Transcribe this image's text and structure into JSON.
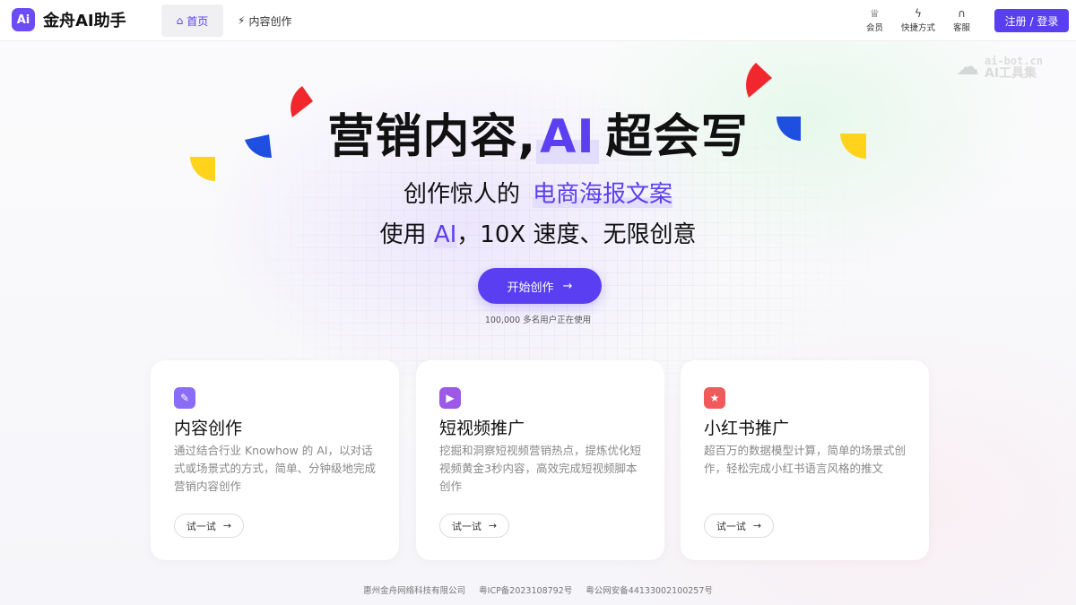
{
  "header": {
    "logo_mark": "Ai",
    "app_name": "金舟AI助手",
    "nav": [
      {
        "label": "首页",
        "icon": "home-icon",
        "active": true
      },
      {
        "label": "内容创作",
        "icon": "lightning-icon",
        "active": false
      }
    ],
    "tools": [
      {
        "label": "会员",
        "icon": "crown-icon"
      },
      {
        "label": "快捷方式",
        "icon": "lightning-icon"
      },
      {
        "label": "客服",
        "icon": "headset-icon"
      }
    ],
    "login_label": "注册 / 登录"
  },
  "watermark": {
    "url": "ai-bot.cn",
    "name": "AI工具集"
  },
  "hero": {
    "title_prefix": "营销内容,",
    "title_ai": "AI",
    "title_suffix": "超会写",
    "sub1_prefix": "创作惊人的",
    "sub1_highlight": "电商海报文案",
    "sub2_prefix": "使用",
    "sub2_ai": "AI",
    "sub2_suffix": "，10X 速度、无限创意",
    "cta_label": "开始创作",
    "cta_arrow": "→",
    "users_note": "100,000 多名用户正在使用"
  },
  "cards": [
    {
      "icon": "edit-icon",
      "icon_color": "#8b6cf7",
      "title": "内容创作",
      "desc": "通过结合行业 Knowhow 的 AI，以对话式或场景式的方式，简单、分钟级地完成营销内容创作",
      "try_label": "试一试",
      "arrow": "→"
    },
    {
      "icon": "play-icon",
      "icon_color": "#9b59e6",
      "title": "短视频推广",
      "desc": "挖掘和洞察短视频营销热点，提炼优化短视频黄金3秒内容，高效完成短视频脚本创作",
      "try_label": "试一试",
      "arrow": "→"
    },
    {
      "icon": "star-icon",
      "icon_color": "#f05a5a",
      "title": "小红书推广",
      "desc": "超百万的数据模型计算，简单的场景式创作，轻松完成小红书语言风格的推文",
      "try_label": "试一试",
      "arrow": "→"
    }
  ],
  "footer": {
    "company": "惠州金舟网络科技有限公司",
    "icp": "粤ICP备2023108792号",
    "police": "粤公网安备44133002100257号"
  },
  "colors": {
    "accent": "#5a3ef2",
    "red": "#f0282d",
    "blue": "#1f4fe0",
    "yellow": "#ffd21c"
  }
}
